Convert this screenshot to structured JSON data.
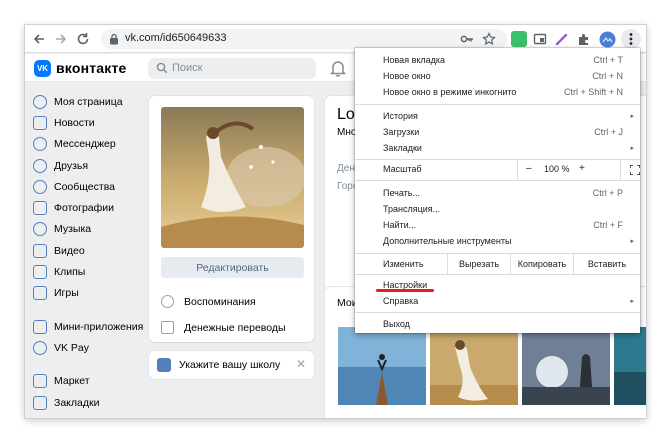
{
  "browser": {
    "url": "vk.com/id650649633",
    "colors": {
      "extension_green": "#3dbf6b",
      "extension_purple": "#a257d8",
      "profile_blue": "#4b7fd6"
    }
  },
  "vk": {
    "logo_text": "VK",
    "brand": "вконтакте",
    "search_placeholder": "Поиск",
    "nav": [
      {
        "label": "Моя страница",
        "icon": "user-circle-icon"
      },
      {
        "label": "Новости",
        "icon": "news-icon"
      },
      {
        "label": "Мессенджер",
        "icon": "message-icon"
      },
      {
        "label": "Друзья",
        "icon": "friends-icon"
      },
      {
        "label": "Сообщества",
        "icon": "communities-icon"
      },
      {
        "label": "Фотографии",
        "icon": "photos-icon"
      },
      {
        "label": "Музыка",
        "icon": "music-icon"
      },
      {
        "label": "Видео",
        "icon": "video-icon"
      },
      {
        "label": "Клипы",
        "icon": "clips-icon"
      },
      {
        "label": "Игры",
        "icon": "games-icon"
      },
      {
        "label": "Мини-приложения",
        "icon": "mini-apps-icon"
      },
      {
        "label": "VK Pay",
        "icon": "vk-pay-icon"
      },
      {
        "label": "Маркет",
        "icon": "market-icon"
      },
      {
        "label": "Закладки",
        "icon": "bookmark-icon"
      }
    ],
    "profile": {
      "edit_label": "Редактировать",
      "memories_label": "Воспоминания",
      "transfers_label": "Денежные переводы"
    },
    "school": {
      "text": "Укажите вашу школу",
      "close": "✕"
    },
    "info": {
      "name_fragment": "Lov",
      "status_fragment": "Мно",
      "row1_fragment": "Ден",
      "row2_fragment": "Горо"
    },
    "photos": {
      "title_fragment": "Мои"
    },
    "accent": "#0077ff"
  },
  "menu": {
    "items_top": [
      {
        "label": "Новая вкладка",
        "shortcut": "Ctrl + T"
      },
      {
        "label": "Новое окно",
        "shortcut": "Ctrl + N"
      },
      {
        "label": "Новое окно в режиме инкогнито",
        "shortcut": "Ctrl + Shift + N"
      }
    ],
    "items_history": [
      {
        "label": "История",
        "shortcut": "",
        "arrow": "▸"
      },
      {
        "label": "Загрузки",
        "shortcut": "Ctrl + J",
        "arrow": ""
      },
      {
        "label": "Закладки",
        "shortcut": "",
        "arrow": "▸"
      }
    ],
    "zoom": {
      "label": "Масштаб",
      "minus": "–",
      "value": "100 %",
      "plus": "+"
    },
    "items_tools": [
      {
        "label": "Печать...",
        "shortcut": "Ctrl + P",
        "arrow": ""
      },
      {
        "label": "Трансляция...",
        "shortcut": "",
        "arrow": ""
      },
      {
        "label": "Найти...",
        "shortcut": "Ctrl + F",
        "arrow": ""
      },
      {
        "label": "Дополнительные инструменты",
        "shortcut": "",
        "arrow": "▸"
      }
    ],
    "edit": {
      "label": "Изменить",
      "cut": "Вырезать",
      "copy": "Копировать",
      "paste": "Вставить"
    },
    "settings": {
      "label": "Настройки"
    },
    "help": {
      "label": "Справка",
      "arrow": "▸"
    },
    "exit": {
      "label": "Выход"
    },
    "highlight_color": "#e01f1f"
  }
}
